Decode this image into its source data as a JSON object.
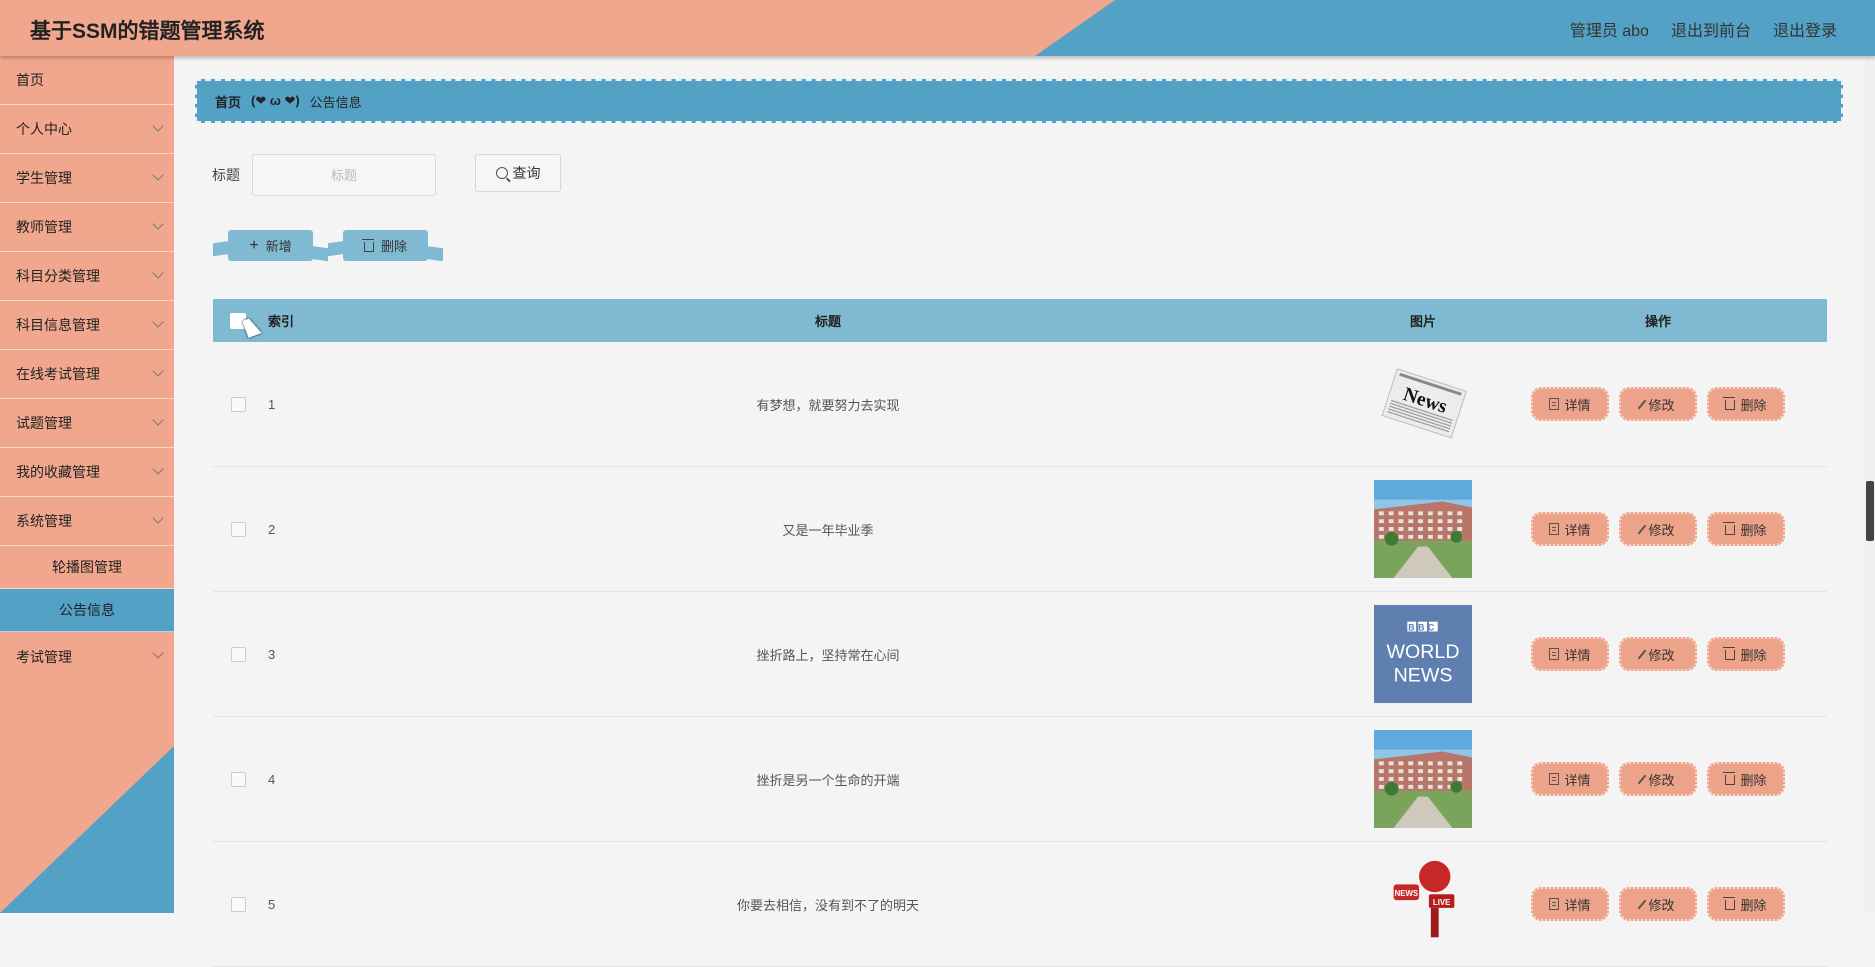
{
  "header": {
    "title": "基于SSM的错题管理系统",
    "admin_label": "管理员 abo",
    "frontend_link": "退出到前台",
    "logout_link": "退出登录"
  },
  "sidebar": {
    "items": [
      {
        "label": "首页",
        "expandable": false
      },
      {
        "label": "个人中心",
        "expandable": true
      },
      {
        "label": "学生管理",
        "expandable": true
      },
      {
        "label": "教师管理",
        "expandable": true
      },
      {
        "label": "科目分类管理",
        "expandable": true
      },
      {
        "label": "科目信息管理",
        "expandable": true
      },
      {
        "label": "在线考试管理",
        "expandable": true
      },
      {
        "label": "试题管理",
        "expandable": true
      },
      {
        "label": "我的收藏管理",
        "expandable": true
      },
      {
        "label": "系统管理",
        "expandable": true
      }
    ],
    "sub_items": [
      {
        "label": "轮播图管理",
        "active": false
      },
      {
        "label": "公告信息",
        "active": true
      }
    ],
    "last_item": {
      "label": "考试管理",
      "expandable": true
    }
  },
  "breadcrumb": {
    "home": "首页",
    "separator": "(❤ ω ❤)",
    "current": "公告信息"
  },
  "search": {
    "label": "标题",
    "placeholder": "标题",
    "value": "",
    "button_label": "查询"
  },
  "actions": {
    "add_label": "新增",
    "delete_label": "删除"
  },
  "table": {
    "headers": {
      "index": "索引",
      "title": "标题",
      "image": "图片",
      "ops": "操作"
    },
    "op_labels": {
      "detail": "详情",
      "edit": "修改",
      "delete": "删除"
    },
    "rows": [
      {
        "index": "1",
        "title": "有梦想，就要努力去实现",
        "image": "news-paper"
      },
      {
        "index": "2",
        "title": "又是一年毕业季",
        "image": "campus-building"
      },
      {
        "index": "3",
        "title": "挫折路上，坚持常在心间",
        "image": "bbc-world-news"
      },
      {
        "index": "4",
        "title": "挫折是另一个生命的开端",
        "image": "campus-building"
      },
      {
        "index": "5",
        "title": "你要去相信，没有到不了的明天",
        "image": "news-microphone"
      }
    ]
  },
  "image_text": {
    "news_word": "News",
    "bbc_line1": "BBC",
    "bbc_line2": "WORLD",
    "bbc_line3": "NEWS",
    "mic_word": "NEWS",
    "live_word": "LIVE"
  },
  "colors": {
    "peach": "#f1a78d",
    "blue": "#54a1c6",
    "light_blue": "#80b9d2",
    "button_peach": "#eda389"
  }
}
